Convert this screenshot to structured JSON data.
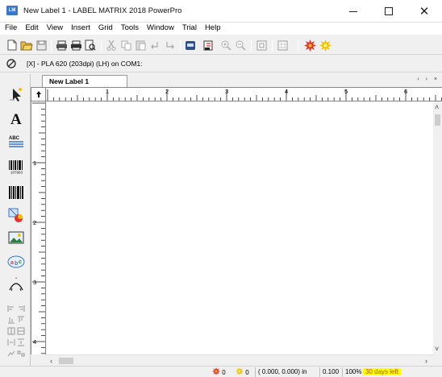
{
  "window": {
    "app_icon_text": "LM",
    "title": "New Label 1 - LABEL MATRIX 2018 PowerPro",
    "minimize": "minimize",
    "maximize": "maximize",
    "close": "close"
  },
  "menu": [
    "File",
    "Edit",
    "View",
    "Insert",
    "Grid",
    "Tools",
    "Window",
    "Trial",
    "Help"
  ],
  "toolbar": {
    "buttons": [
      "new-icon",
      "open-icon",
      "save-icon",
      "print-icon",
      "print-all-icon",
      "print-preview-icon",
      "cut-icon",
      "copy-icon",
      "paste-icon",
      "undo-icon",
      "redo-icon",
      "database-icon",
      "label-properties-icon",
      "zoom-in-icon",
      "zoom-out-icon",
      "fit-icon",
      "grid-icon",
      "red-starburst-icon",
      "yellow-starburst-icon"
    ]
  },
  "printer": {
    "text": "[X] - PLA 620 (203dpi) (LH) on COM1:"
  },
  "tab": {
    "label": "New Label 1",
    "nav": "‹ › ×"
  },
  "rulers": {
    "horizontal_labels": [
      "1",
      "2",
      "3",
      "4",
      "5",
      "6"
    ],
    "vertical_labels": [
      "1",
      "2",
      "3",
      "4"
    ]
  },
  "left_tools": [
    "pointer-tool-icon",
    "text-tool-icon",
    "paragraph-tool-icon",
    "barcode-1d-tool-icon",
    "barcode-2d-tool-icon",
    "shape-tool-icon",
    "image-tool-icon",
    "counter-tool-icon",
    "arc-text-tool-icon"
  ],
  "status": {
    "red_count": "0",
    "yellow_count": "0",
    "coords": "( 0.000,  0.000) in",
    "step": "0.100",
    "zoom": "100%",
    "trial": "30 days left"
  },
  "colors": {
    "accent": "#3b76c8",
    "trial_bg": "#ffff00",
    "trial_text": "#b35a00"
  }
}
